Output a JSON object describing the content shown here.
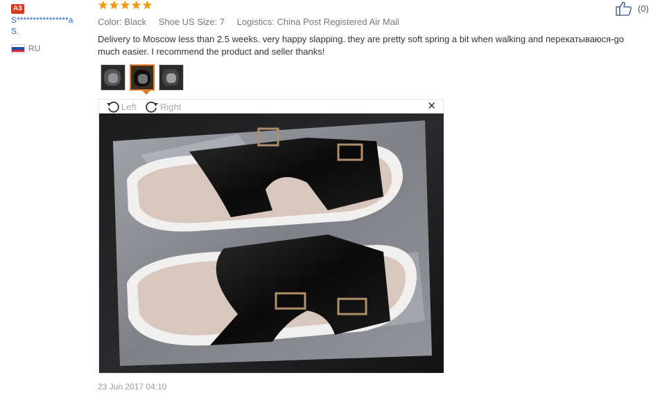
{
  "user": {
    "level_badge": "A3",
    "name_line1": "S****************a",
    "name_line2": "S.",
    "country_code": "RU",
    "flag_colors": [
      "#ffffff",
      "#1f4fb0",
      "#d8262e"
    ]
  },
  "review": {
    "rating": 5,
    "star_color": "#f39c12",
    "attributes": [
      "Color: Black",
      "Shoe US Size: 7",
      "Logistics: China Post Registered Air Mail"
    ],
    "text": "Delivery to Moscow less than 2.5 weeks. very happy slapping. they are pretty soft spring a bit when walking and перекатываюся-go much easier. I recommend the product and seller thanks!",
    "date": "23 Jun 2017 04:10"
  },
  "viewer": {
    "rotate_left_label": "Left",
    "rotate_right_label": "Right",
    "close_symbol": "✕"
  },
  "helpful": {
    "count": "(0)"
  }
}
